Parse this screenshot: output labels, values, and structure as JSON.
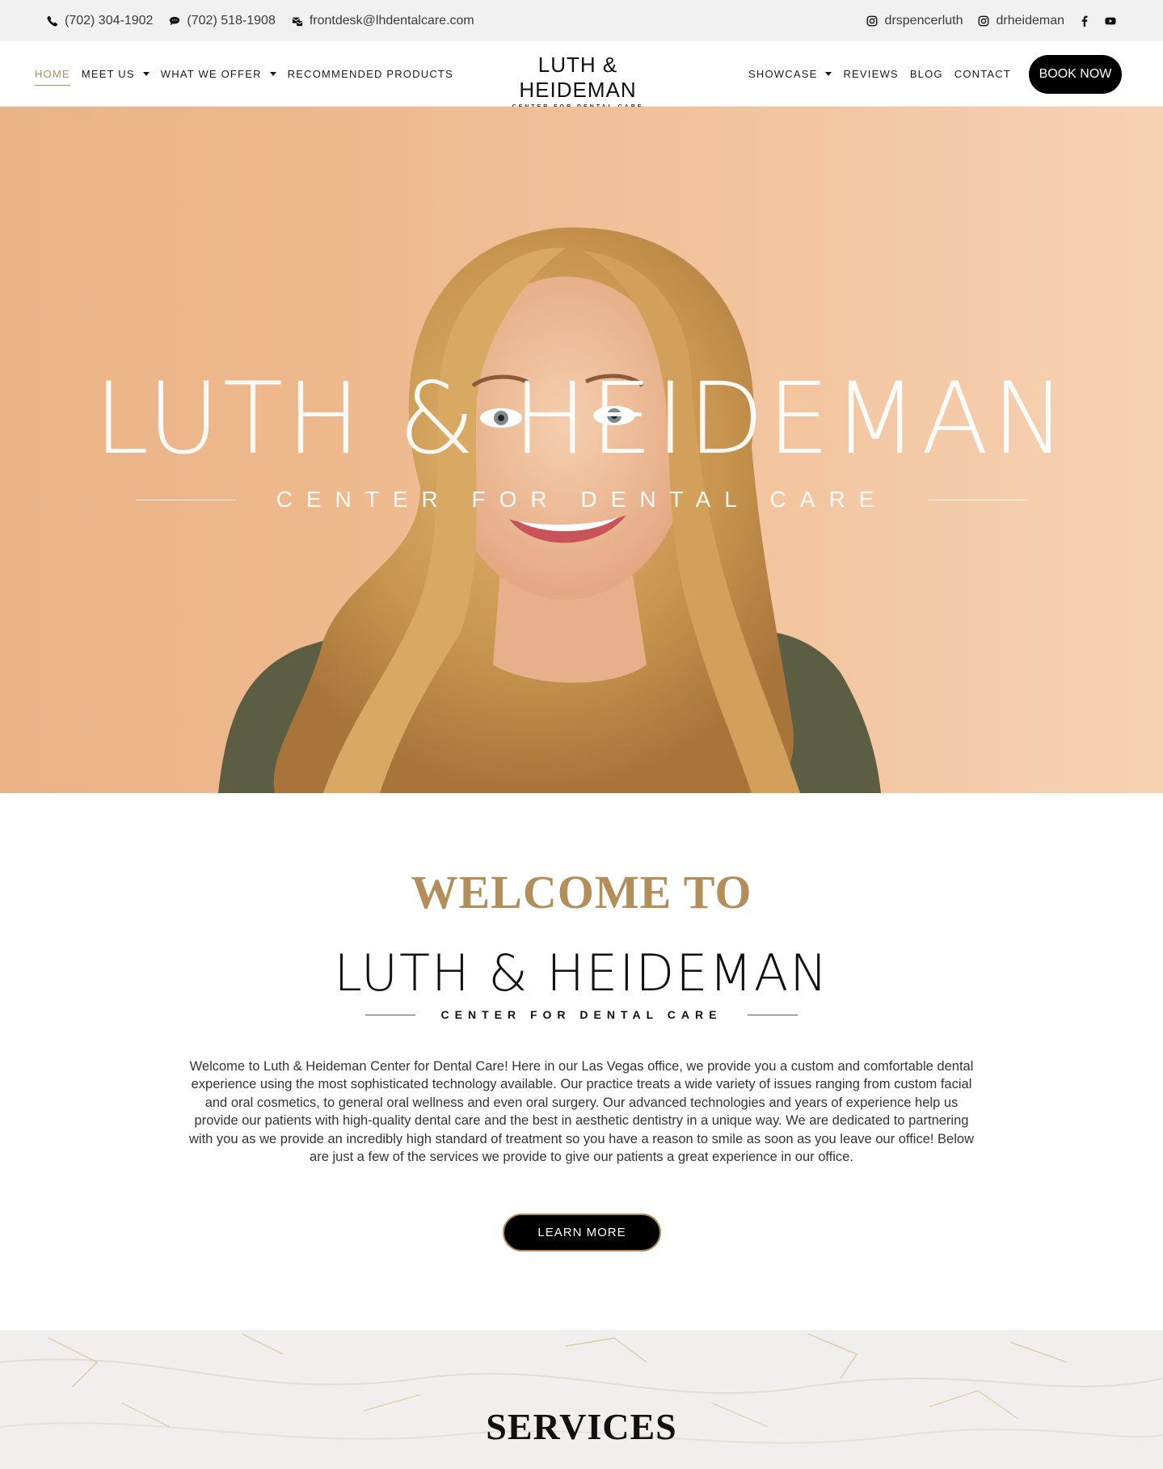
{
  "topbar": {
    "phone1": "(702) 304-1902",
    "phone2": "(702) 518-1908",
    "email": "frontdesk@lhdentalcare.com",
    "instagram1": "drspencerluth",
    "instagram2": "drheideman",
    "icons": [
      "phone-icon",
      "chat-icon",
      "email-icon",
      "instagram-icon",
      "instagram-icon",
      "facebook-icon",
      "youtube-icon"
    ]
  },
  "nav": {
    "left": [
      {
        "label": "HOME",
        "active": true
      },
      {
        "label": "MEET US",
        "dropdown": true
      },
      {
        "label": "WHAT WE OFFER",
        "dropdown": true
      },
      {
        "label": "RECOMMENDED PRODUCTS"
      }
    ],
    "right": [
      {
        "label": "SHOWCASE",
        "dropdown": true
      },
      {
        "label": "REVIEWS"
      },
      {
        "label": "BLOG"
      },
      {
        "label": "CONTACT"
      }
    ],
    "book_label": "BOOK NOW"
  },
  "logo": {
    "name": "LUTH & HEIDEMAN",
    "tagline": "CENTER FOR DENTAL CARE"
  },
  "hero": {
    "title": "LUTH & HEIDEMAN",
    "subtitle": "CENTER FOR DENTAL CARE"
  },
  "welcome": {
    "heading": "WELCOME TO",
    "logo_name": "LUTH & HEIDEMAN",
    "logo_tagline": "CENTER FOR DENTAL CARE",
    "body": "Welcome to Luth & Heideman Center for Dental Care! Here in our Las Vegas office, we provide you a custom and comfortable dental experience using the most sophisticated technology available. Our practice treats a wide variety of issues ranging from custom facial and oral cosmetics, to general oral wellness and even oral surgery. Our advanced technologies and years of experience help us provide our patients with high-quality dental care and the best in aesthetic dentistry in a unique way. We are dedicated to partnering with you as we provide an incredibly high standard of treatment so you have a reason to smile as soon as you leave our office! Below are just a few of the services we provide to give our patients a great experience in our office.",
    "button": "LEARN MORE"
  },
  "services": {
    "heading": "SERVICES"
  },
  "colors": {
    "accent_gold": "#b48e5a",
    "active_nav": "#b08a5a",
    "button_black": "#000000",
    "hero_peach": "#efb98e",
    "topbar_bg": "#f1f1f1"
  }
}
